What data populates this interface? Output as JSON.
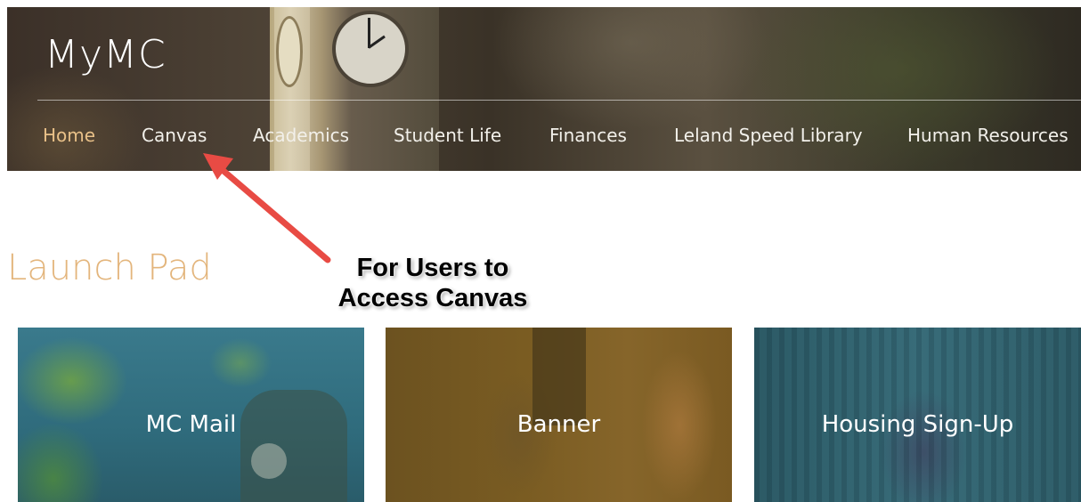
{
  "header": {
    "logo_text": "MyMC",
    "nav": [
      {
        "label": "Home",
        "active": true
      },
      {
        "label": "Canvas",
        "active": false
      },
      {
        "label": "Academics",
        "active": false
      },
      {
        "label": "Student Life",
        "active": false
      },
      {
        "label": "Finances",
        "active": false
      },
      {
        "label": "Leland Speed Library",
        "active": false
      },
      {
        "label": "Human Resources",
        "active": false
      }
    ]
  },
  "launch_pad": {
    "title": "Launch Pad",
    "tiles": [
      {
        "label": "MC Mail"
      },
      {
        "label": "Banner"
      },
      {
        "label": "Housing Sign-Up"
      }
    ]
  },
  "annotation": {
    "callout_line1": "For Users to",
    "callout_line2": "Access Canvas",
    "arrow_color": "#e84b44"
  },
  "colors": {
    "nav_active": "#e8c088",
    "launch_title": "#e3b57c",
    "tile_label": "#ffffff"
  }
}
